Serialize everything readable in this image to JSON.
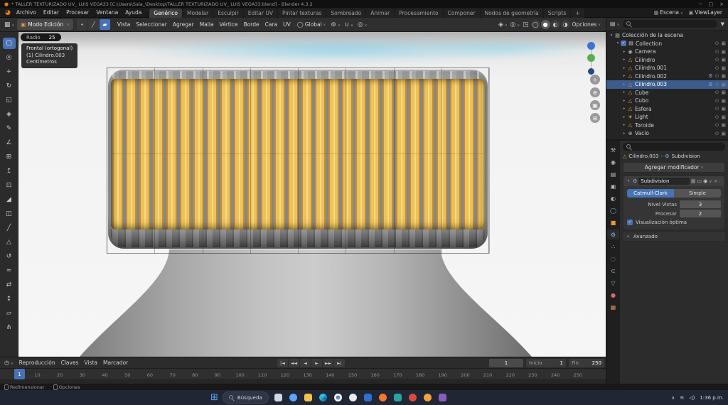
{
  "title_bar": {
    "title": "* TALLER TEXTURIZADO UV_ LUIS VEGA33 [C:\\Users\\Sala_\\Desktop\\TALLER TEXTURIZADO UV_ LUIS VEGA33.blend] - Blender 4.3.2",
    "window_controls": {
      "minimize": "─",
      "maximize": "□",
      "close": "×"
    }
  },
  "menu_bar": {
    "menus": [
      "Archivo",
      "Editar",
      "Procesar",
      "Ventana",
      "Ayuda"
    ],
    "workspaces": [
      "Genérico",
      "Modelar",
      "Esculpir",
      "Editar UV",
      "Pintar texturas",
      "Sombreado",
      "Animar",
      "Procesamiento",
      "Componer",
      "Nodos de geometría",
      "Scripts"
    ],
    "active_workspace": "Genérico",
    "add_workspace": "+",
    "scene": "Escena",
    "view_layer": "ViewLayer"
  },
  "tool_header": {
    "mode": "Modo Edición",
    "select_modes": [
      {
        "name": "vertex-select-mode",
        "glyph": "∙"
      },
      {
        "name": "edge-select-mode",
        "glyph": "╱"
      },
      {
        "name": "face-select-mode",
        "glyph": "▰",
        "active": true
      }
    ],
    "menus": [
      "Vista",
      "Seleccionar",
      "Agregar",
      "Malla",
      "Vértice",
      "Borde",
      "Cara",
      "UV"
    ],
    "orientation": "Global",
    "shading": [
      {
        "name": "wireframe-shading-button",
        "glyph": "◯"
      },
      {
        "name": "solid-shading-button",
        "glyph": "●",
        "active": true
      },
      {
        "name": "material-preview-shading-button",
        "glyph": "◐"
      },
      {
        "name": "rendered-shading-button",
        "glyph": "◑"
      }
    ],
    "options": "Opciones"
  },
  "tool_settings": {
    "radio_label": "Radio",
    "radio_value": "25"
  },
  "viewport": {
    "overlay": [
      "Frontal (ortogonal)",
      "(1) Cilindro.003",
      "Centímetros"
    ]
  },
  "left_toolbar": {
    "tools": [
      {
        "name": "select-box-tool",
        "glyph": "▢",
        "active": true
      },
      {
        "name": "cursor-tool",
        "glyph": "◎"
      },
      {
        "name": "move-tool",
        "glyph": "+"
      },
      {
        "name": "rotate-tool",
        "glyph": "↻"
      },
      {
        "name": "scale-tool",
        "glyph": "◱"
      },
      {
        "name": "transform-tool",
        "glyph": "◈"
      },
      {
        "name": "annotate-tool",
        "glyph": "✎"
      },
      {
        "name": "measure-tool",
        "glyph": "∠"
      },
      {
        "name": "add-cube-tool",
        "glyph": "⊞"
      },
      {
        "name": "extrude-region-tool",
        "glyph": "↥"
      },
      {
        "name": "inset-faces-tool",
        "glyph": "⊡"
      },
      {
        "name": "bevel-tool",
        "glyph": "◢"
      },
      {
        "name": "loop-cut-tool",
        "glyph": "◫"
      },
      {
        "name": "knife-tool",
        "glyph": "╱"
      },
      {
        "name": "poly-build-tool",
        "glyph": "△"
      },
      {
        "name": "spin-tool",
        "glyph": "↺"
      },
      {
        "name": "smooth-tool",
        "glyph": "≈"
      },
      {
        "name": "edge-slide-tool",
        "glyph": "⇄"
      },
      {
        "name": "shrink-fatten-tool",
        "glyph": "↕"
      },
      {
        "name": "shear-tool",
        "glyph": "▱"
      },
      {
        "name": "rip-region-tool",
        "glyph": "⋔"
      }
    ]
  },
  "outliner": {
    "icon_defs": {
      "collection": {
        "glyph": "▤",
        "color": "#cfcfcf"
      },
      "camera": {
        "glyph": "◉",
        "color": "#b5b5b5"
      },
      "mesh": {
        "glyph": "△",
        "color": "#e8953c"
      },
      "light": {
        "glyph": "☀",
        "color": "#e8d44a"
      },
      "empty": {
        "glyph": "⊕",
        "color": "#c0c0c0"
      }
    },
    "rows": [
      {
        "label": "Colección de la escena",
        "depth": 0,
        "icon": "collection"
      },
      {
        "label": "Collection",
        "depth": 1,
        "icon": "collection",
        "checkbox": true
      },
      {
        "label": "Camera",
        "depth": 2,
        "icon": "camera"
      },
      {
        "label": "Cilindro",
        "depth": 2,
        "icon": "mesh"
      },
      {
        "label": "Cilindro.001",
        "depth": 2,
        "icon": "mesh"
      },
      {
        "label": "Cilindro.002",
        "depth": 2,
        "icon": "mesh",
        "modifier": true
      },
      {
        "label": "Cilindro.003",
        "depth": 2,
        "icon": "mesh",
        "modifier": true,
        "selected": true
      },
      {
        "label": "Cube",
        "depth": 2,
        "icon": "mesh"
      },
      {
        "label": "Cubo",
        "depth": 2,
        "icon": "mesh"
      },
      {
        "label": "Esfera",
        "depth": 2,
        "icon": "mesh"
      },
      {
        "label": "Light",
        "depth": 2,
        "icon": "light"
      },
      {
        "label": "Toroide",
        "depth": 2,
        "icon": "mesh"
      },
      {
        "label": "Vacío",
        "depth": 2,
        "icon": "empty"
      }
    ]
  },
  "properties": {
    "tabs": [
      {
        "name": "tool-tab",
        "glyph": "⚒",
        "color": "#b8b8b8"
      },
      {
        "name": "render-tab",
        "glyph": "◉",
        "color": "#b8b8b8"
      },
      {
        "name": "output-tab",
        "glyph": "▤",
        "color": "#b8b8b8"
      },
      {
        "name": "view-layer-tab",
        "glyph": "▣",
        "color": "#b8b8b8"
      },
      {
        "name": "scene-tab",
        "glyph": "◐",
        "color": "#b8b8b8"
      },
      {
        "name": "world-tab",
        "glyph": "◯",
        "color": "#7fb1de"
      },
      {
        "name": "object-tab",
        "glyph": "■",
        "color": "#e8953c"
      },
      {
        "name": "modifiers-tab",
        "glyph": "⚙",
        "color": "#8ab4e8",
        "active": true
      },
      {
        "name": "particles-tab",
        "glyph": "∴",
        "color": "#b8b8b8"
      },
      {
        "name": "physics-tab",
        "glyph": "◌",
        "color": "#7fb1de"
      },
      {
        "name": "constraints-tab",
        "glyph": "⊂",
        "color": "#b8b8b8"
      },
      {
        "name": "data-tab",
        "glyph": "▽",
        "color": "#6fbf6f"
      },
      {
        "name": "material-tab",
        "glyph": "●",
        "color": "#d66a6a"
      },
      {
        "name": "texture-tab",
        "glyph": "▦",
        "color": "#d68a6a"
      }
    ],
    "breadcrumb": {
      "object": "Cilindro.003",
      "separator": "›",
      "modifier": "Subdivision"
    },
    "add_modifier": "Agregar modificador",
    "modifier": {
      "name": "Subdivision",
      "types": [
        "Catmull-Clark",
        "Simple"
      ],
      "active_type": "Catmull-Clark",
      "fields": [
        {
          "label": "Nivel Vistas",
          "value": "3"
        },
        {
          "label": "Procesar",
          "value": "2"
        }
      ],
      "checkbox_label": "Visualización óptima",
      "checkbox_checked": true,
      "advanced_label": "Avanzado"
    }
  },
  "timeline": {
    "menus": [
      "Reproducción",
      "Claves",
      "Vista",
      "Marcador"
    ],
    "playback": [
      {
        "name": "jump-start-button",
        "glyph": "|◄"
      },
      {
        "name": "prev-keyframe-button",
        "glyph": "◄◄"
      },
      {
        "name": "play-reverse-button",
        "glyph": "◄"
      },
      {
        "name": "play-button",
        "glyph": "►"
      },
      {
        "name": "next-keyframe-button",
        "glyph": "►►"
      },
      {
        "name": "jump-end-button",
        "glyph": "►|"
      }
    ],
    "current_frame": "1",
    "start_label": "Inicio",
    "start_value": "1",
    "end_label": "Fin",
    "end_value": "250",
    "ticks": [
      1,
      10,
      20,
      30,
      40,
      50,
      60,
      70,
      80,
      90,
      100,
      110,
      120,
      130,
      140,
      150,
      160,
      170,
      180,
      190,
      200,
      210,
      220,
      230,
      240,
      250
    ]
  },
  "status_bar": {
    "items": [
      {
        "name": "resize-status",
        "label": "Redimensionar"
      },
      {
        "name": "options-status",
        "label": "Opciones"
      }
    ]
  },
  "taskbar": {
    "search_label": "Búsqueda",
    "time": "1:36 p.m.",
    "apps": [
      {
        "name": "task-view-icon",
        "shape": "square",
        "color": "#cfd8e3"
      },
      {
        "name": "widgets-icon",
        "shape": "circle",
        "color": "#58a6ff"
      },
      {
        "name": "folder-icon",
        "shape": "folder",
        "color": "#f3c14b"
      },
      {
        "name": "edge-icon",
        "shape": "circle",
        "color": "edge"
      },
      {
        "name": "chrome-icon",
        "shape": "circle",
        "color": "chrome"
      },
      {
        "name": "app-icon-white",
        "shape": "circle",
        "color": "#e8eaed"
      },
      {
        "name": "app-icon-blue",
        "shape": "square",
        "color": "#2f6fd0"
      },
      {
        "name": "blender-icon",
        "shape": "circle",
        "color": "#f5792a"
      },
      {
        "name": "app-icon-teal",
        "shape": "square",
        "color": "#27a59e"
      },
      {
        "name": "app-icon-red",
        "shape": "circle",
        "color": "#d94a3f"
      },
      {
        "name": "app-icon-orange",
        "shape": "circle",
        "color": "#f2a33c"
      },
      {
        "name": "app-icon-purple",
        "shape": "square",
        "color": "#8a5cc2"
      }
    ]
  },
  "colors": {
    "accent": "#4772b3",
    "selection_yellow": "#eec25a",
    "blender_orange": "#e87d0d"
  }
}
